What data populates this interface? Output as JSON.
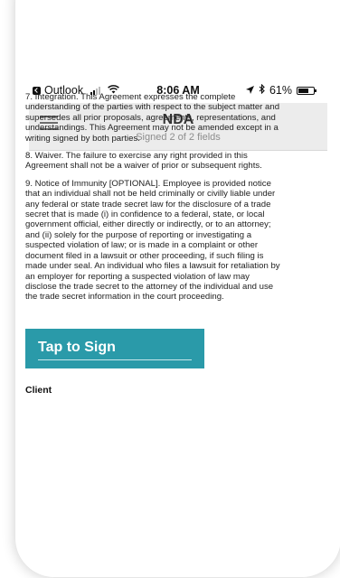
{
  "status_bar": {
    "back_app": "Outlook",
    "time": "8:06 AM",
    "battery_percent": "61%"
  },
  "nav": {
    "title": "NDA",
    "subtitle": "Signed 2 of 2 fields"
  },
  "document": {
    "paragraphs": [
      "7.   Integration. This Agreement expresses the complete understanding of the parties with respect to the subject matter and supersedes all prior proposals, agreements, representations, and understandings. This Agreement may not be amended except in a writing signed by both parties.",
      "8.   Waiver. The failure to exercise any right provided in this Agreement shall not be a waiver of prior or subsequent rights.",
      "9.   Notice of Immunity [OPTIONAL]. Employee is provided notice that an individual shall not be held criminally or civilly liable under any federal or state trade secret law for the disclosure of a trade secret that is made (i) in confidence to a federal, state, or local government official, either directly or indirectly, or to an attorney; and (ii) solely for the purpose of reporting or investigating a suspected violation of law; or is made in a complaint or other document filed in a lawsuit or other proceeding, if such filing is made under seal. An individual who files a lawsuit for retaliation by an employer for reporting a suspected violation of law may disclose the trade secret to the attorney of the individual and use the trade secret information in the court proceeding."
    ]
  },
  "sign": {
    "button_label": "Tap to Sign",
    "signer_label": "Client"
  },
  "colors": {
    "accent": "#2a9aa9",
    "nav_background": "#ececec"
  },
  "icons": [
    "back-arrow-icon",
    "cellular-signal-icon",
    "wifi-icon",
    "location-arrow-icon",
    "bluetooth-icon",
    "battery-icon",
    "hamburger-menu-icon"
  ]
}
